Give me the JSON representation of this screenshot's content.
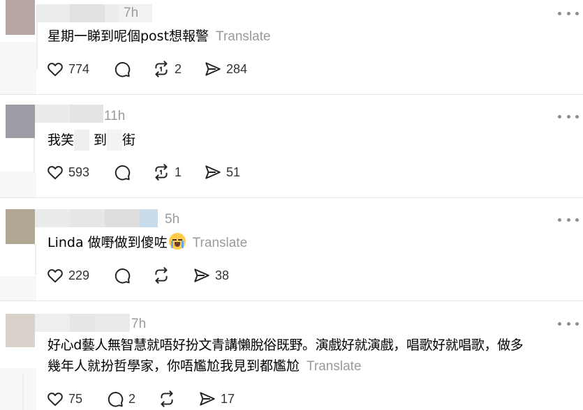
{
  "posts": [
    {
      "time": "7h",
      "text": "星期一睇到呢個post想報警",
      "translate": "Translate",
      "likes": "774",
      "reposts": "2",
      "shares": "284",
      "avatar_color": "#b6a6a3"
    },
    {
      "time": "11h",
      "text_parts": [
        "我笑",
        "到",
        "街"
      ],
      "likes": "593",
      "reposts": "1",
      "shares": "51",
      "avatar_color": "#9e9ba5"
    },
    {
      "time": "5h",
      "text": "Linda 做嘢做到傻咗",
      "translate": "Translate",
      "emoji": "loudly-crying-face",
      "likes": "229",
      "reposts": "",
      "shares": "38",
      "avatar_color": "#b2a793"
    },
    {
      "time": "7h",
      "text_line1": "好心d藝人無智慧就唔好扮文青講懶脫俗既野。演戲好就演戲，唱歌好就唱歌，做多",
      "text_line2": "幾年人就扮哲學家，你唔尷尬我見到都尷尬",
      "translate": "Translate",
      "likes": "75",
      "comments": "2",
      "reposts": "",
      "shares": "17",
      "avatar_color": "#d8d2cb"
    }
  ],
  "icons": {
    "like": "heart-icon",
    "comment": "comment-icon",
    "repost": "repost-icon",
    "share": "share-icon",
    "more": "more-options-icon"
  }
}
